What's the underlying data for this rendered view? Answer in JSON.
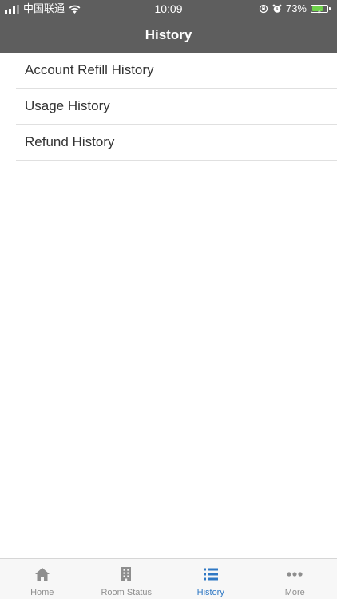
{
  "status_bar": {
    "carrier": "中国联通",
    "time": "10:09",
    "battery_percent": "73%",
    "battery_level": 0.73
  },
  "header": {
    "title": "History"
  },
  "menu": {
    "items": [
      {
        "label": "Account Refill History"
      },
      {
        "label": "Usage History"
      },
      {
        "label": "Refund History"
      }
    ]
  },
  "tabbar": {
    "active_index": 2,
    "tabs": [
      {
        "label": "Home",
        "icon": "home-icon"
      },
      {
        "label": "Room Status",
        "icon": "building-icon"
      },
      {
        "label": "History",
        "icon": "list-icon"
      },
      {
        "label": "More",
        "icon": "more-icon"
      }
    ]
  },
  "colors": {
    "header_bg": "#5e5e5e",
    "active_tab": "#2f78c4",
    "inactive_tab": "#8e8e8e",
    "battery_fill": "#6fd34b"
  }
}
